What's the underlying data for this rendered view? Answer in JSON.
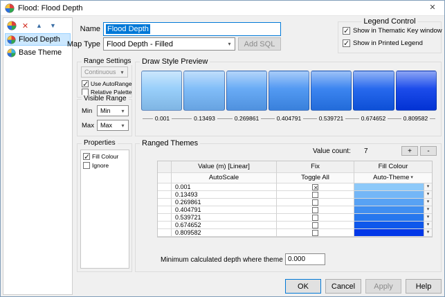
{
  "window": {
    "title": "Flood: Flood Depth"
  },
  "icons": {
    "close": "✕",
    "delete": "✕",
    "up": "▲",
    "down": "▼",
    "dropdown": "▾"
  },
  "sidebar": {
    "items": [
      {
        "label": "Flood Depth"
      },
      {
        "label": "Base Theme"
      }
    ]
  },
  "form": {
    "name_label": "Name",
    "name_value": "Flood Depth",
    "map_type_label": "Map Type",
    "map_type_value": "Flood Depth - Filled",
    "add_sql_label": "Add SQL"
  },
  "legend_control": {
    "title": "Legend Control",
    "items": [
      {
        "label": "Show in Thematic Key window",
        "checked": true
      },
      {
        "label": "Show in Printed Legend",
        "checked": true
      }
    ]
  },
  "range_settings": {
    "title": "Range Settings",
    "mode": "Continuous",
    "items": [
      {
        "label": "Use AutoRange",
        "checked": true
      },
      {
        "label": "Relative Palette",
        "checked": false
      }
    ]
  },
  "visible_range": {
    "title": "Visible Range",
    "min_label": "Min",
    "min_value": "Min",
    "max_label": "Max",
    "max_value": "Max"
  },
  "preview": {
    "title": "Draw Style Preview",
    "swatches": [
      {
        "value": "0.001",
        "color": "#8dc9f9"
      },
      {
        "value": "0.13493",
        "color": "#73b6f7"
      },
      {
        "value": "0.269861",
        "color": "#58a2f4"
      },
      {
        "value": "0.404791",
        "color": "#3f8ef1"
      },
      {
        "value": "0.539721",
        "color": "#2677ee"
      },
      {
        "value": "0.674652",
        "color": "#0f58eb"
      },
      {
        "value": "0.809582",
        "color": "#0238e8"
      }
    ]
  },
  "properties": {
    "title": "Properties",
    "items": [
      {
        "label": "Fill Colour",
        "checked": true
      },
      {
        "label": "Ignore",
        "checked": false
      }
    ]
  },
  "ranged_themes": {
    "title": "Ranged Themes",
    "value_count_label": "Value count:",
    "value_count": "7",
    "add_label": "+",
    "remove_label": "-",
    "columns": {
      "value": "Value (m) [Linear]",
      "fix": "Fix",
      "fill": "Fill Colour"
    },
    "subheaders": {
      "value": "AutoScale",
      "fix": "Toggle All",
      "fill": "Auto-Theme"
    },
    "rows": [
      {
        "value": "0.001",
        "fix": true,
        "color": "#8dc9f9"
      },
      {
        "value": "0.13493",
        "fix": false,
        "color": "#73b6f7"
      },
      {
        "value": "0.269861",
        "fix": false,
        "color": "#58a2f4"
      },
      {
        "value": "0.404791",
        "fix": false,
        "color": "#3f8ef1"
      },
      {
        "value": "0.539721",
        "fix": false,
        "color": "#2677ee"
      },
      {
        "value": "0.674652",
        "fix": false,
        "color": "#0f58eb"
      },
      {
        "value": "0.809582",
        "fix": false,
        "color": "#0238e8"
      }
    ],
    "min_depth_label": "Minimum calculated depth where theme applies (m)",
    "min_depth_value": "0.000"
  },
  "footer": {
    "ok": "OK",
    "cancel": "Cancel",
    "apply": "Apply",
    "help": "Help"
  },
  "colors": {
    "selection": "#0078d7"
  }
}
